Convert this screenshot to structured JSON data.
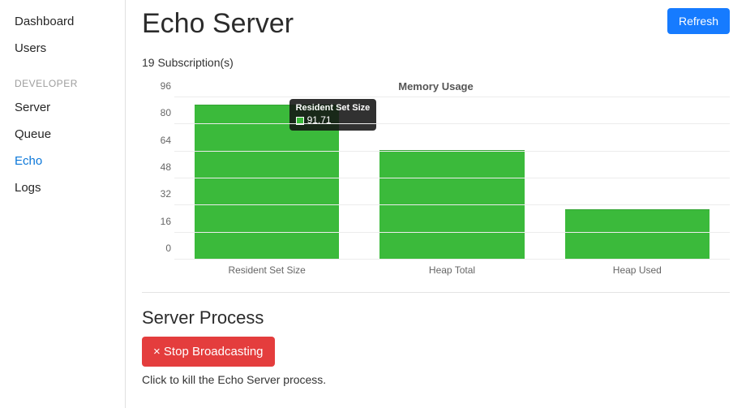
{
  "sidebar": {
    "items_main": [
      {
        "label": "Dashboard"
      },
      {
        "label": "Users"
      }
    ],
    "section_label": "DEVELOPER",
    "items_dev": [
      {
        "label": "Server",
        "active": false
      },
      {
        "label": "Queue",
        "active": false
      },
      {
        "label": "Echo",
        "active": true
      },
      {
        "label": "Logs",
        "active": false
      }
    ]
  },
  "header": {
    "title": "Echo Server",
    "refresh_label": "Refresh"
  },
  "subscriptions_text": "19 Subscription(s)",
  "chart_data": {
    "type": "bar",
    "title": "Memory Usage",
    "categories": [
      "Resident Set Size",
      "Heap Total",
      "Heap Used"
    ],
    "values": [
      91.71,
      65,
      30
    ],
    "ylabel": "",
    "xlabel": "",
    "ylim": [
      0,
      96
    ],
    "y_ticks": [
      0,
      16,
      32,
      48,
      64,
      80,
      96
    ],
    "tooltip": {
      "label": "Resident Set Size",
      "value": "91.71"
    },
    "bar_color": "#3bba3b"
  },
  "server_process": {
    "title": "Server Process",
    "stop_label": "× Stop Broadcasting",
    "hint": "Click to kill the Echo Server process."
  }
}
